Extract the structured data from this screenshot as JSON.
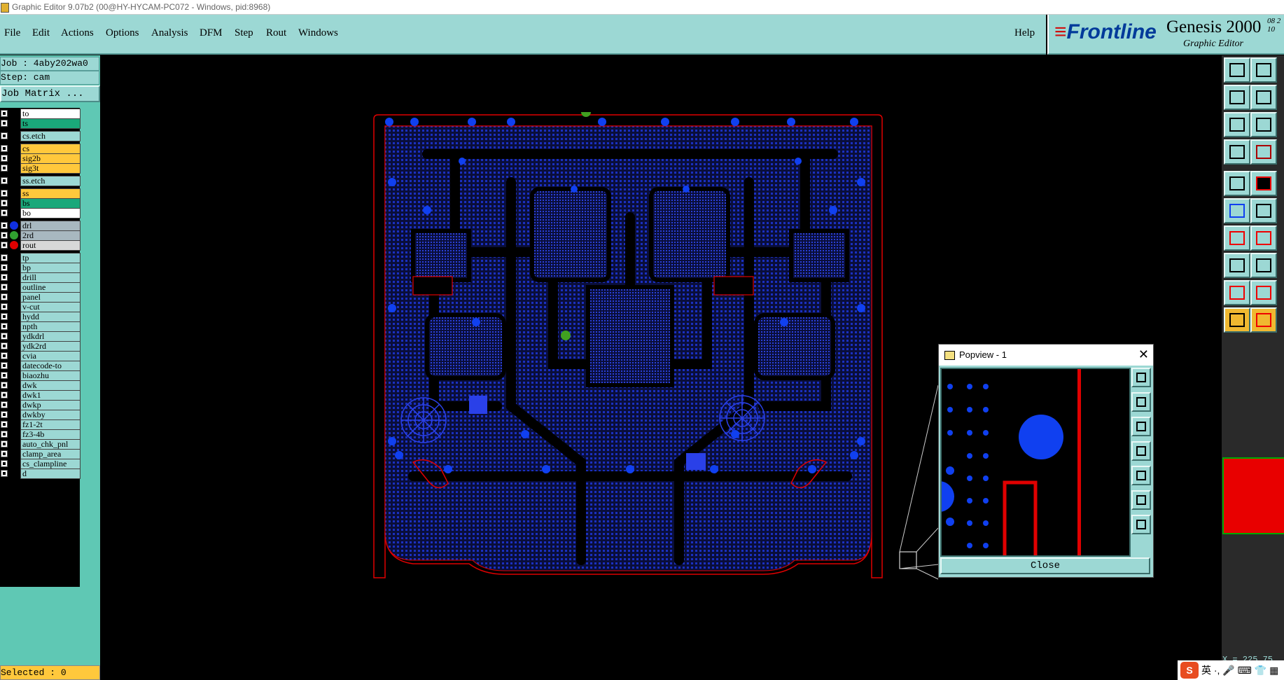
{
  "window": {
    "title": "Graphic Editor 9.07b2 (00@HY-HYCAM-PC072 - Windows, pid:8968)"
  },
  "menu": {
    "items": [
      "File",
      "Edit",
      "Actions",
      "Options",
      "Analysis",
      "DFM",
      "Step",
      "Rout",
      "Windows"
    ],
    "help": "Help"
  },
  "logo": {
    "brand": "Frontline",
    "product": "Genesis 2000",
    "subtitle": "Graphic Editor",
    "version": "08 2 10"
  },
  "job": {
    "job_label": "Job : 4aby202wa0",
    "step_label": "Step: cam",
    "matrix_button": "Job Matrix ..."
  },
  "layers": [
    {
      "name": "to",
      "color": "#ffffff"
    },
    {
      "name": "ts",
      "color": "#1aa87a"
    },
    {
      "name": "cs.etch",
      "color": "#9cd8d4"
    },
    {
      "name": "cs",
      "color": "#ffc83c"
    },
    {
      "name": "sig2b",
      "color": "#ffc83c"
    },
    {
      "name": "sig3t",
      "color": "#ffc83c"
    },
    {
      "name": "ss.etch",
      "color": "#9cd8d4"
    },
    {
      "name": "ss",
      "color": "#ffc83c"
    },
    {
      "name": "bs",
      "color": "#1aa87a"
    },
    {
      "name": "bo",
      "color": "#ffffff"
    },
    {
      "name": "drl",
      "color": "#a8b8c0",
      "dot": "#1030e0"
    },
    {
      "name": "2rd",
      "color": "#a8b8c0",
      "dot": "#30a030"
    },
    {
      "name": "rout",
      "color": "#d8d8d8",
      "dot": "#e00000"
    },
    {
      "name": "tp",
      "color": "#9cd8d4"
    },
    {
      "name": "bp",
      "color": "#9cd8d4"
    },
    {
      "name": "drill",
      "color": "#9cd8d4"
    },
    {
      "name": "outline",
      "color": "#9cd8d4"
    },
    {
      "name": "panel",
      "color": "#9cd8d4"
    },
    {
      "name": "v-cut",
      "color": "#9cd8d4"
    },
    {
      "name": "hydd",
      "color": "#9cd8d4"
    },
    {
      "name": "npth",
      "color": "#9cd8d4"
    },
    {
      "name": "ydkdrl",
      "color": "#9cd8d4"
    },
    {
      "name": "ydk2rd",
      "color": "#9cd8d4"
    },
    {
      "name": "cvia",
      "color": "#9cd8d4"
    },
    {
      "name": "datecode-to",
      "color": "#9cd8d4"
    },
    {
      "name": "biaozhu",
      "color": "#9cd8d4"
    },
    {
      "name": "dwk",
      "color": "#9cd8d4"
    },
    {
      "name": "dwk1",
      "color": "#9cd8d4"
    },
    {
      "name": "dwkp",
      "color": "#9cd8d4"
    },
    {
      "name": "dwkby",
      "color": "#9cd8d4"
    },
    {
      "name": "fz1-2t",
      "color": "#9cd8d4"
    },
    {
      "name": "fz3-4b",
      "color": "#9cd8d4"
    },
    {
      "name": "auto_chk_pnl",
      "color": "#9cd8d4"
    },
    {
      "name": "clamp_area",
      "color": "#9cd8d4"
    },
    {
      "name": "cs_clampline",
      "color": "#9cd8d4"
    },
    {
      "name": "d",
      "color": "#9cd8d4"
    }
  ],
  "status": {
    "selected": "Selected : 0",
    "coord": "X = 225.75"
  },
  "popview": {
    "title": "Popview - 1",
    "close_label": "Close"
  },
  "tray": {
    "ime": "英"
  },
  "colors": {
    "panel_bg": "#9cd8d4",
    "left_bg": "#5fc8b4",
    "board_blue": "#1028d0",
    "rout_red": "#e00000"
  }
}
